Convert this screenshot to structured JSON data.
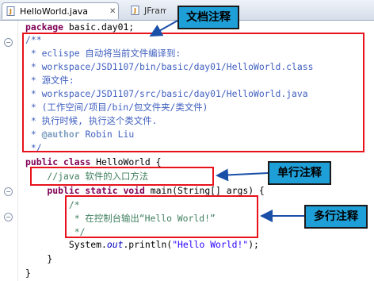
{
  "tabs": [
    {
      "label": "HelloWorld.java",
      "active": true,
      "close": "✕"
    },
    {
      "label": "JFrameHe",
      "active": false
    }
  ],
  "code": {
    "package_kw": "package",
    "package_name": " basic.day01;",
    "jd_open": "/**",
    "jd_lines": [
      " * eclispe 自动将当前文件编译到:",
      " * workspace/JSD1107/bin/basic/day01/HelloWorld.class",
      " * 源文件:",
      " * workspace/JSD1107/src/basic/day01/HelloWorld.java",
      " * (工作空间/项目/bin/包文件夹/类文件)",
      " * 执行时候, 执行这个类文件."
    ],
    "jd_author_prefix": " * ",
    "jd_author_tag": "@author",
    "jd_author_name": " Robin Liu",
    "jd_close": " */",
    "class_kw1": "public",
    "class_kw2": " class",
    "class_name": " HelloWorld {",
    "single_comment": "    //java 软件的入口方法",
    "main_kw1": "    public",
    "main_kw2": " static",
    "main_kw3": " void",
    "main_rest": " main(String[] args) {",
    "ml_open": "        /*",
    "ml_body": "         * 在控制台输出“Hello World!”",
    "ml_close": "         */",
    "println_pre": "        System.",
    "println_field": "out",
    "println_mid": ".println(",
    "println_str": "\"Hello World!\"",
    "println_post": ");",
    "close_method": "    }",
    "close_class": "}"
  },
  "annotations": {
    "doc_comment": "文档注释",
    "single_line": "单行注释",
    "multi_line": "多行注释"
  },
  "colors": {
    "keyword": "#7f0055",
    "javadoc": "#3f5fbf",
    "comment": "#3f7f5f",
    "string": "#2a00ff",
    "highlight_box": "#e8121c",
    "callout_bg": "#1f9fd8"
  },
  "icons": [
    "java-file-icon",
    "close-icon",
    "fold-icon"
  ]
}
